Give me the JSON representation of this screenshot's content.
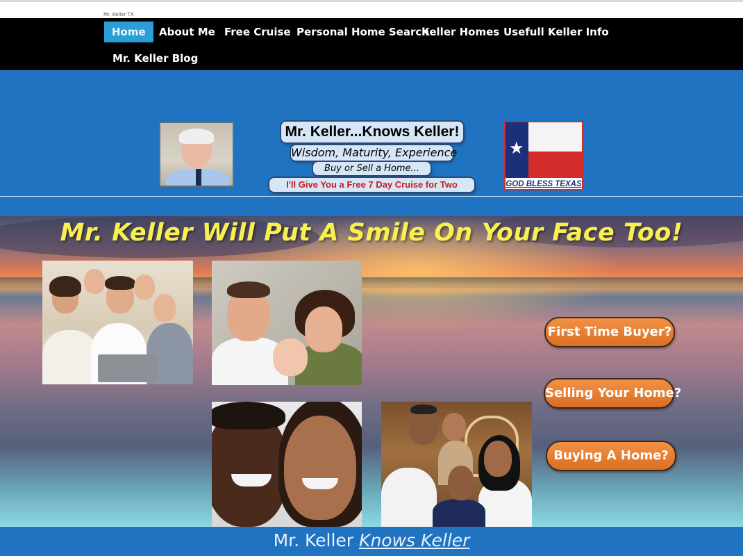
{
  "site_tag": "Mr. Keller TX",
  "nav": {
    "items": [
      "Home",
      "About Me",
      "Free Cruise",
      "Personal Home Search",
      "Keller Homes",
      "Usefull Keller Info",
      "Mr. Keller Blog"
    ],
    "active": "Home"
  },
  "header": {
    "title": "Mr. Keller...Knows Keller!",
    "subtitle": "Wisdom, Maturity, Experience",
    "tagline": "Buy or Sell a Home...",
    "offer": "I'll Give You a Free 7 Day Cruise for Two",
    "flag_caption": "GOD BLESS TEXAS"
  },
  "hero": {
    "headline": "Mr. Keller Will Put A Smile On Your Face Too!",
    "buttons": [
      "First Time Buyer?",
      "Selling Your Home?",
      "Buying A Home?"
    ]
  },
  "footer": {
    "text": "Mr. Keller",
    "link": "Knows Keller"
  },
  "icons": {
    "flag_star": "star-icon"
  },
  "colors": {
    "nav_bg": "#000000",
    "nav_active": "#2a9fd6",
    "header_bg": "#1f73c1",
    "headline": "#f8f050",
    "cta": "#e77f30",
    "offer_text": "#d01818"
  }
}
